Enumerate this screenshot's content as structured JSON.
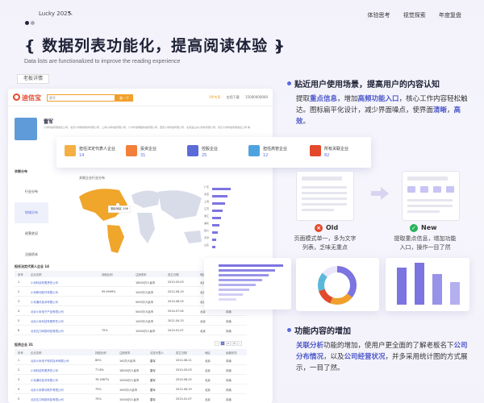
{
  "header": {
    "brand": "Lucky 2025",
    "nav": [
      "体验思考",
      "视觉探索",
      "年度复盘"
    ]
  },
  "hero": {
    "title": "{ 数据列表功能化，提高阅读体验 }",
    "subtitle": "Data lists are functionalized to improve the reading experience",
    "tag": "老板详情"
  },
  "shot": {
    "logo": "迪信宝",
    "search_value": "雷军",
    "search_button": "查一下",
    "vip": "VIP专享",
    "app": "应用下载",
    "phone": "15000000000",
    "company_name": "雷军",
    "company_desc": "小米科技有限责任公司，北京小米移动软件有限公司，上海小米科技有限公司，广州华多网络科技有限公司，西安小米科技有限公司，北京金山办公软件有限公司，武汉小米科技有限责任公司 等",
    "cards": [
      {
        "label": "担任法定代表人企业",
        "num": "14"
      },
      {
        "label": "投资企业",
        "num": "31"
      },
      {
        "label": "控股企业",
        "num": "25"
      },
      {
        "label": "担任高管企业",
        "num": "12"
      },
      {
        "label": "所有关联企业",
        "num": "82"
      }
    ],
    "section_map": "关联分布",
    "map_tabs": [
      "行业分布",
      "地域分布",
      "经营状况",
      "注册资本"
    ],
    "map_title": "关联企业行业分布",
    "map_tip": "湖北地区 196",
    "map_bars": [
      {
        "name": "广东",
        "v": 0.95
      },
      {
        "name": "北京",
        "v": 0.8
      },
      {
        "name": "上海",
        "v": 0.65
      },
      {
        "name": "江苏",
        "v": 0.55
      },
      {
        "name": "浙江",
        "v": 0.45
      },
      {
        "name": "湖北",
        "v": 0.38
      },
      {
        "name": "四川",
        "v": 0.3
      },
      {
        "name": "天津",
        "v": 0.22
      },
      {
        "name": "山东",
        "v": 0.15
      }
    ],
    "section_legal": "担任法定代表人企业 14",
    "legal_head": [
      "序号",
      "企业名称",
      "持股比例",
      "注册资本",
      "成立日期",
      "地区",
      "经营状况"
    ],
    "legal_rows": [
      [
        "1",
        "小米科技有限责任公司",
        "",
        "18500万人民币",
        "2010-03-03",
        "北京",
        "存续"
      ],
      [
        "2",
        "小米移动软件有限公司",
        "99.9999%",
        "1000万人民币",
        "2012-06-19",
        "北京",
        "存续"
      ],
      [
        "3",
        "小米通讯技术有限公司",
        "",
        "5000万人民币",
        "2010-08-25",
        "北京",
        "存续"
      ],
      [
        "4",
        "北京小米电子产品有限公司",
        "",
        "5000万人民币",
        "2014-07-04",
        "北京",
        "存续"
      ],
      [
        "5",
        "北京小米科技有限责任公司",
        "",
        "1000万人民币",
        "2011-04-15",
        "北京",
        "存续"
      ],
      [
        "6",
        "北京瓦力网络科技有限公司",
        "75%",
        "10000万人民币",
        "2015-01-07",
        "北京",
        "存续"
      ]
    ],
    "pager": [
      "1",
      "2",
      "3"
    ],
    "section_invest": "投资企业 31",
    "invest_head": [
      "序号",
      "企业名称",
      "持股比例",
      "注册资本",
      "法定代表人",
      "成立日期",
      "地区",
      "经营状况"
    ],
    "invest_rows": [
      [
        "1",
        "北京小米电子软件技术有限公司",
        "80%",
        "100万人民币",
        "雷军",
        "2012-06-21",
        "北京",
        "存续"
      ],
      [
        "2",
        "小米科技有限责任公司",
        "77.8%",
        "18500万人民币",
        "雷军",
        "2010-03-03",
        "北京",
        "存续"
      ],
      [
        "3",
        "小米通讯技术有限公司",
        "78.1667%",
        "10000万人民币",
        "雷军",
        "2010-08-25",
        "北京",
        "存续"
      ],
      [
        "4",
        "北京小米移动软件有限公司",
        "75%",
        "1000万人民币",
        "雷军",
        "2012-06-19",
        "北京",
        "存续"
      ],
      [
        "5",
        "北京瓦力网络科技有限公司",
        "70%",
        "10000万人民币",
        "雷军",
        "2015-01-07",
        "北京",
        "存续"
      ]
    ]
  },
  "right": {
    "h1": "贴近用户使用场景，提高用户的内容认知",
    "p1_a": "提取",
    "p1_b": "重点信息",
    "p1_c": "，增加",
    "p1_d": "高频功能入口",
    "p1_e": "，核心工作内容轻松触达。图标扁平化设计，减少界面噪点，使界面",
    "p1_f": "清晰",
    "p1_g": "，",
    "p1_h": "高效",
    "p1_i": "。",
    "old_label": "Old",
    "old_desc": "页面模式单一，多为文字列表，乏味无重点",
    "new_label": "New",
    "new_desc": "提取重点信息，增加功能入口，操作一目了然",
    "h2": "功能内容的增加",
    "p2_a": "关联分析",
    "p2_b": "功能的增加，使用户更全面的了解老板名下",
    "p2_c": "公司分布情况",
    "p2_d": "，以及",
    "p2_e": "公司经营状况",
    "p2_f": "，并多采用统计图的方式展示，一目了然。"
  },
  "colors": {
    "accent": "#5b6bd8",
    "orange": "#f1a02b",
    "red": "#e24a2b",
    "green": "#27b35a"
  }
}
